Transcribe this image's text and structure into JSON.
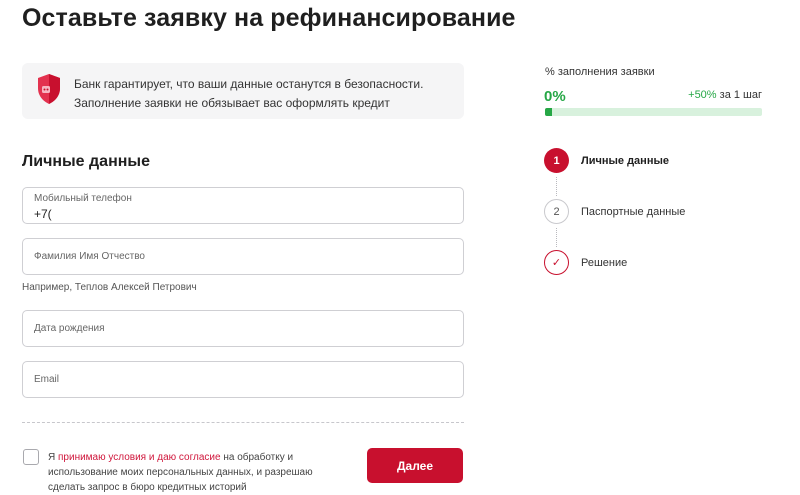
{
  "page": {
    "title": "Оставьте заявку на рефинансирование"
  },
  "notice": {
    "icon": "shield-icon",
    "line1": "Банк гарантирует, что ваши данные останутся в безопасности.",
    "line2": "Заполнение заявки не обязывает вас оформлять кредит"
  },
  "form": {
    "section_title": "Личные данные",
    "phone": {
      "label": "Мобильный телефон",
      "value": "+7("
    },
    "fullname": {
      "placeholder": "Фамилия Имя Отчество",
      "hint": "Например, Теплов Алексей Петрович"
    },
    "birthdate": {
      "placeholder": "Дата рождения"
    },
    "email": {
      "placeholder": "Email"
    },
    "consent": {
      "checked": false,
      "prefix": "Я ",
      "link": "принимаю условия и даю согласие",
      "suffix": " на обработку и использование моих персональных данных, и разрешаю сделать запрос в бюро кредитных историй"
    },
    "next_label": "Далее"
  },
  "progress": {
    "label": "% заполнения заявки",
    "value_text": "0%",
    "fraction": 0.03,
    "increment": "+50%",
    "increment_suffix": " за 1 шаг"
  },
  "steps": [
    {
      "number": "1",
      "label": "Личные данные",
      "state": "active"
    },
    {
      "number": "2",
      "label": "Паспортные данные",
      "state": "pending"
    },
    {
      "number": "✓",
      "label": "Решение",
      "state": "final"
    }
  ],
  "colors": {
    "accent": "#c8102e",
    "success": "#26a746",
    "success_track": "#d8f1dd",
    "notice_bg": "#f5f5f6"
  }
}
